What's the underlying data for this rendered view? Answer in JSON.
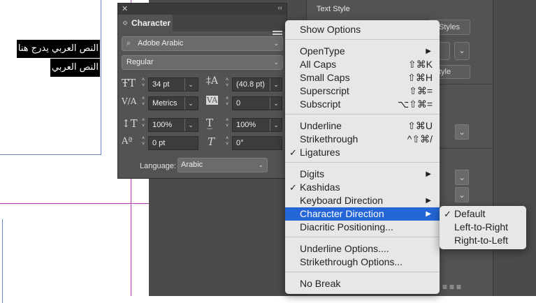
{
  "document": {
    "arabic_line1": "النص العربي يدرج هنا",
    "arabic_line2": "النص العربي"
  },
  "right_panel": {
    "title": "Text Style",
    "button_styles": "Styles",
    "button_style": "tyle"
  },
  "character_panel": {
    "tab_title": "Character",
    "font_family": "Adobe Arabic",
    "font_style": "Regular",
    "font_size": "34 pt",
    "leading": "(40.8 pt)",
    "kerning": "Metrics",
    "tracking": "0",
    "vertical_scale": "100%",
    "horizontal_scale": "100%",
    "baseline_shift": "0 pt",
    "skew": "0°",
    "language_label": "Language:",
    "language": "Arabic"
  },
  "context_menu": {
    "items": [
      {
        "label": "Show Options",
        "shortcut": "",
        "checked": false,
        "submenu": false
      },
      {
        "label": "OpenType",
        "shortcut": "",
        "checked": false,
        "submenu": true
      },
      {
        "label": "All Caps",
        "shortcut": "⇧⌘K",
        "checked": false,
        "submenu": false
      },
      {
        "label": "Small Caps",
        "shortcut": "⇧⌘H",
        "checked": false,
        "submenu": false
      },
      {
        "label": "Superscript",
        "shortcut": "⇧⌘=",
        "checked": false,
        "submenu": false
      },
      {
        "label": "Subscript",
        "shortcut": "⌥⇧⌘=",
        "checked": false,
        "submenu": false
      },
      {
        "label": "Underline",
        "shortcut": "⇧⌘U",
        "checked": false,
        "submenu": false
      },
      {
        "label": "Strikethrough",
        "shortcut": "^⇧⌘/",
        "checked": false,
        "submenu": false
      },
      {
        "label": "Ligatures",
        "shortcut": "",
        "checked": true,
        "submenu": false
      },
      {
        "label": "Digits",
        "shortcut": "",
        "checked": false,
        "submenu": true
      },
      {
        "label": "Kashidas",
        "shortcut": "",
        "checked": true,
        "submenu": false
      },
      {
        "label": "Keyboard Direction",
        "shortcut": "",
        "checked": false,
        "submenu": true
      },
      {
        "label": "Character Direction",
        "shortcut": "",
        "checked": false,
        "submenu": true,
        "highlighted": true
      },
      {
        "label": "Diacritic Positioning...",
        "shortcut": "",
        "checked": false,
        "submenu": false
      },
      {
        "label": "Underline Options....",
        "shortcut": "",
        "checked": false,
        "submenu": false
      },
      {
        "label": "Strikethrough Options...",
        "shortcut": "",
        "checked": false,
        "submenu": false
      },
      {
        "label": "No Break",
        "shortcut": "",
        "checked": false,
        "submenu": false
      }
    ],
    "checkmark": "✓",
    "submenu_arrow": "▶"
  },
  "direction_submenu": {
    "items": [
      {
        "label": "Default",
        "checked": true
      },
      {
        "label": "Left-to-Right",
        "checked": false
      },
      {
        "label": "Right-to-Left",
        "checked": false
      }
    ]
  },
  "colors": {
    "highlight": "#2466d6",
    "menu_bg": "#e7e7e7",
    "panel_bg": "#535353"
  }
}
